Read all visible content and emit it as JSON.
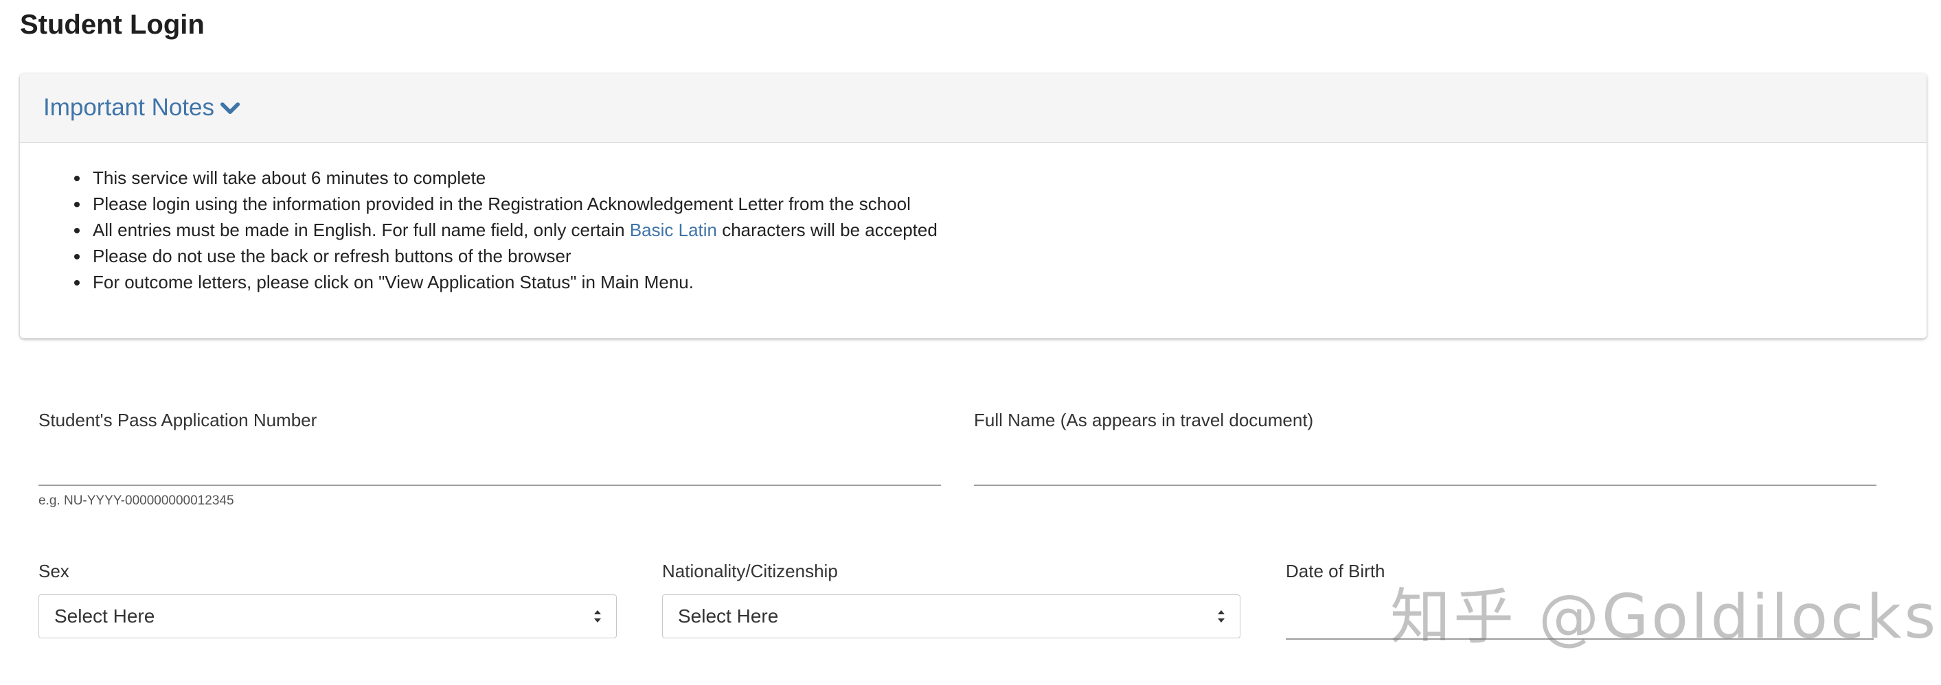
{
  "page": {
    "title": "Student Login"
  },
  "notes": {
    "title": "Important Notes",
    "items": [
      {
        "text": "This service will take about 6 minutes to complete"
      },
      {
        "text": "Please login using the information provided in the Registration Acknowledgement Letter from the school"
      },
      {
        "before": "All entries must be made in English. For full name field, only certain ",
        "link": "Basic Latin",
        "after": " characters will be accepted"
      },
      {
        "text": "Please do not use the back or refresh buttons of the browser"
      },
      {
        "text": "For outcome letters, please click on \"View Application Status\" in Main Menu."
      }
    ]
  },
  "form": {
    "application_number": {
      "label": "Student's Pass Application Number",
      "value": "",
      "hint": "e.g. NU-YYYY-000000000012345"
    },
    "full_name": {
      "label": "Full Name (As appears in travel document)",
      "value": ""
    },
    "sex": {
      "label": "Sex",
      "selected": "Select Here"
    },
    "nationality": {
      "label": "Nationality/Citizenship",
      "selected": "Select Here"
    },
    "dob": {
      "label": "Date of Birth",
      "value": ""
    }
  },
  "watermark": {
    "text": "知乎 @Goldilocks"
  },
  "colors": {
    "link": "#3f74a8",
    "header_bg": "#f5f5f5"
  },
  "icons": {
    "notes_toggle": "chevron-down-icon",
    "select": "select-arrows-icon"
  }
}
